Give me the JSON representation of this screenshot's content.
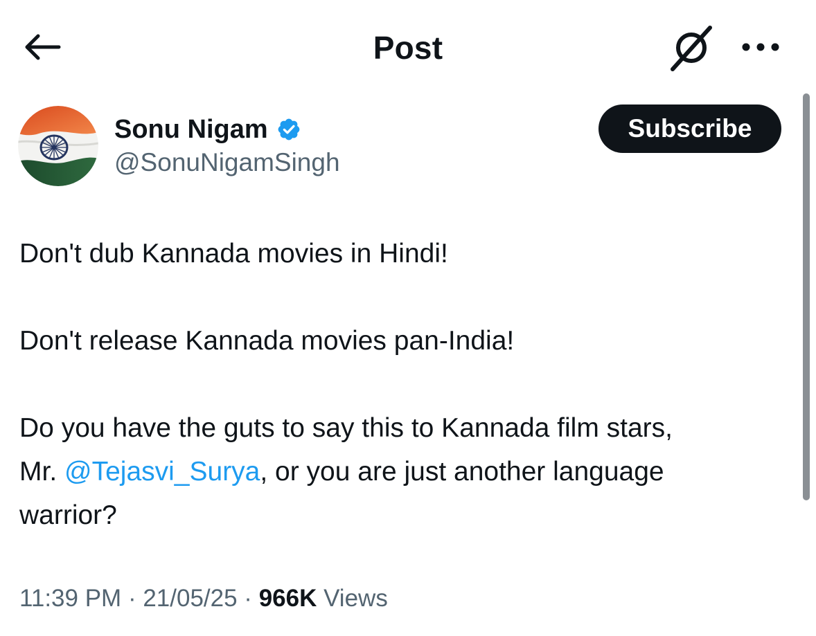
{
  "header": {
    "title": "Post",
    "back_icon": "arrow-left-icon",
    "grok_icon": "grok-icon",
    "more_icon": "more-horizontal-icon"
  },
  "author": {
    "display_name": "Sonu Nigam",
    "handle": "@SonuNigamSingh",
    "verified": true,
    "verified_color": "#1d9bf0",
    "avatar": "indian-flag-avatar"
  },
  "subscribe_label": "Subscribe",
  "tweet": {
    "line1": "Don't dub Kannada movies in Hindi!",
    "line2": "Don't release Kannada movies pan-India!",
    "line3a": "Do you have the guts to say this to Kannada film stars,",
    "line3b_prefix": "Mr. ",
    "mention": "@Tejasvi_Surya",
    "line3b_suffix": ", or you are just another language",
    "line3c": "warrior?"
  },
  "meta": {
    "time": "11:39 PM",
    "separator": " · ",
    "date": "21/05/25",
    "views_count": "966K",
    "views_label": " Views"
  },
  "colors": {
    "text": "#0f1419",
    "secondary": "#536471",
    "link": "#1d9bf0",
    "button_bg": "#0f1419"
  }
}
